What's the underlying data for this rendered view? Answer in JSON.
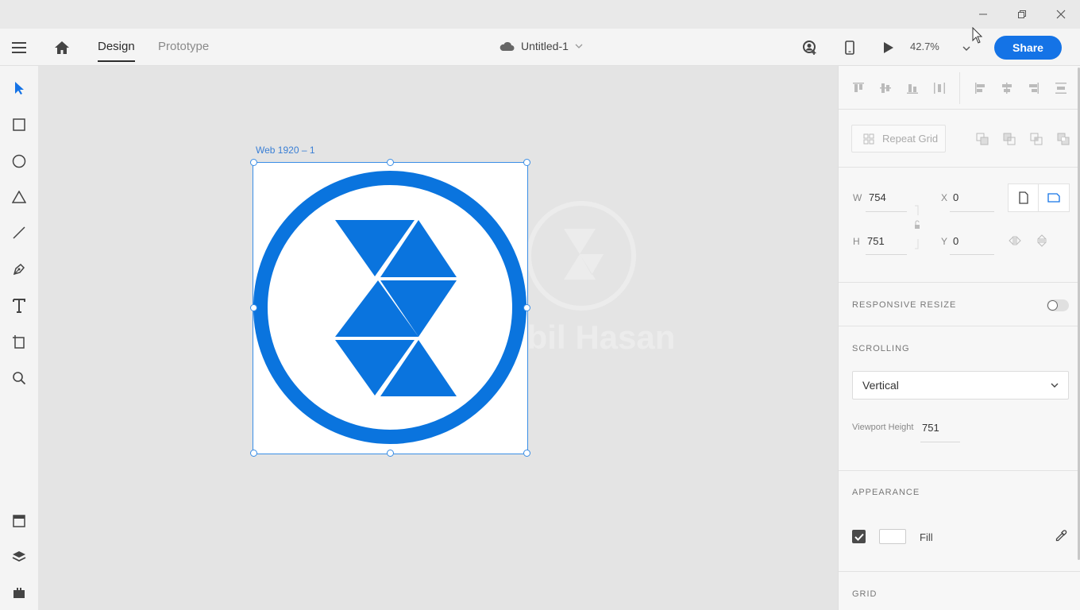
{
  "header": {
    "tabs": [
      {
        "label": "Design",
        "active": true
      },
      {
        "label": "Prototype",
        "active": false
      }
    ],
    "document_title": "Untitled-1",
    "zoom": "42.7%",
    "share_label": "Share"
  },
  "canvas": {
    "artboard_label": "Web 1920 – 1",
    "watermark_text": "bbil Hasan"
  },
  "properties": {
    "repeat_grid_label": "Repeat Grid",
    "w_label": "W",
    "w_value": "754",
    "h_label": "H",
    "h_value": "751",
    "x_label": "X",
    "x_value": "0",
    "y_label": "Y",
    "y_value": "0",
    "responsive_resize_label": "RESPONSIVE RESIZE",
    "responsive_resize_on": false,
    "scrolling_label": "SCROLLING",
    "scrolling_value": "Vertical",
    "viewport_height_label": "Viewport Height",
    "viewport_height_value": "751",
    "appearance_label": "APPEARANCE",
    "fill_label": "Fill",
    "fill_checked": true,
    "fill_color": "#ffffff",
    "grid_label": "GRID"
  },
  "colors": {
    "accent": "#1473e6",
    "logo_blue": "#0a74de",
    "selection": "#3a8ee6"
  }
}
